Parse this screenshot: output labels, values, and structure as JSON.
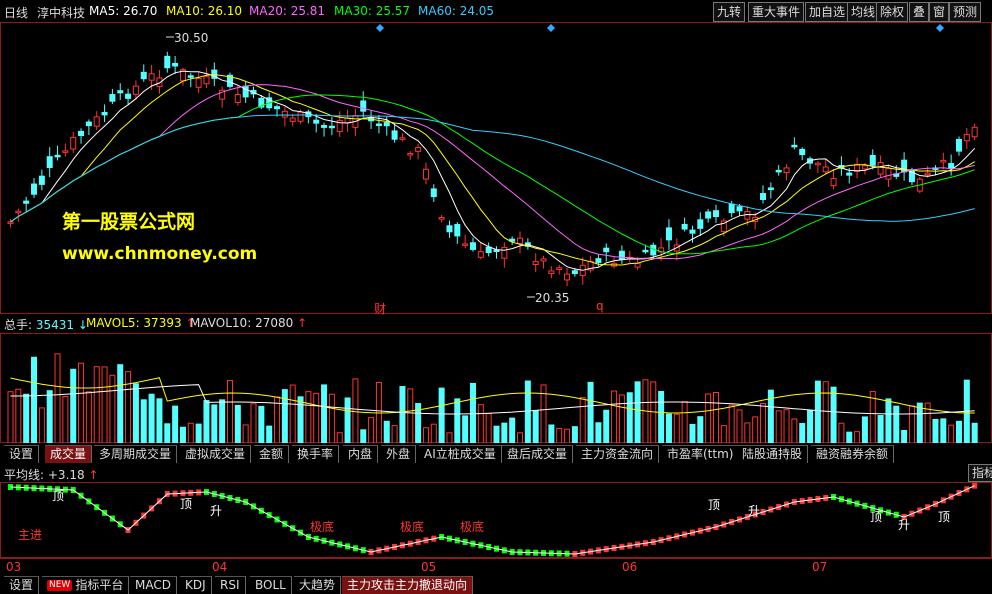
{
  "header": {
    "period": "日线",
    "stock": "淳中科技",
    "ma": [
      {
        "label": "MA5",
        "value": "26.70",
        "color": "#ffffff"
      },
      {
        "label": "MA10",
        "value": "26.10",
        "color": "#ffff00"
      },
      {
        "label": "MA20",
        "value": "25.81",
        "color": "#ff66ff"
      },
      {
        "label": "MA30",
        "value": "25.57",
        "color": "#00ff00"
      },
      {
        "label": "MA60",
        "value": "24.05",
        "color": "#33ccff"
      }
    ],
    "buttons": [
      "九转",
      "重大事件",
      "加自选",
      "均线",
      "除权",
      "叠",
      "窗",
      "预测"
    ]
  },
  "main_chart": {
    "high_label": "30.50",
    "low_label": "20.35",
    "markers": [
      "财",
      "q"
    ],
    "watermark_title": "第一股票公式网",
    "watermark_url": "www.chnmoney.com"
  },
  "volume": {
    "total_label": "总手",
    "total_value": "35431",
    "total_arrow": "↓",
    "mavol5_label": "MAVOL5",
    "mavol5_value": "37393",
    "mavol5_arrow": "↑",
    "mavol10_label": "MAVOL10",
    "mavol10_value": "27080",
    "mavol10_arrow": "↑"
  },
  "volume_tabs": [
    "设置",
    "成交量",
    "多周期成交量",
    "虚拟成交量",
    "金额",
    "换手率",
    "内盘",
    "外盘",
    "AI立桩成交量",
    "盘后成交量",
    "主力资金流向",
    "市盈率(ttm)",
    "陆股通持股",
    "融资融券余额"
  ],
  "indicator": {
    "label": "平均线",
    "value": "+3.18",
    "arrow": "↑",
    "right_tab": "指标",
    "annotations": [
      "主进",
      "顶",
      "顶",
      "升",
      "极底",
      "极底",
      "极底",
      "顶",
      "升",
      "顶",
      "升",
      "顶"
    ]
  },
  "dates": [
    "03",
    "04",
    "05",
    "06",
    "07"
  ],
  "bottom_tabs": [
    "设置",
    "指标平台",
    "MACD",
    "KDJ",
    "RSI",
    "BOLL",
    "大趋势",
    "主力攻击主力撤退动向"
  ],
  "bottom_new_badge": "NEW",
  "colors": {
    "up": "#ff3333",
    "down": "#54ffff",
    "grid": "#8b1a1a"
  }
}
